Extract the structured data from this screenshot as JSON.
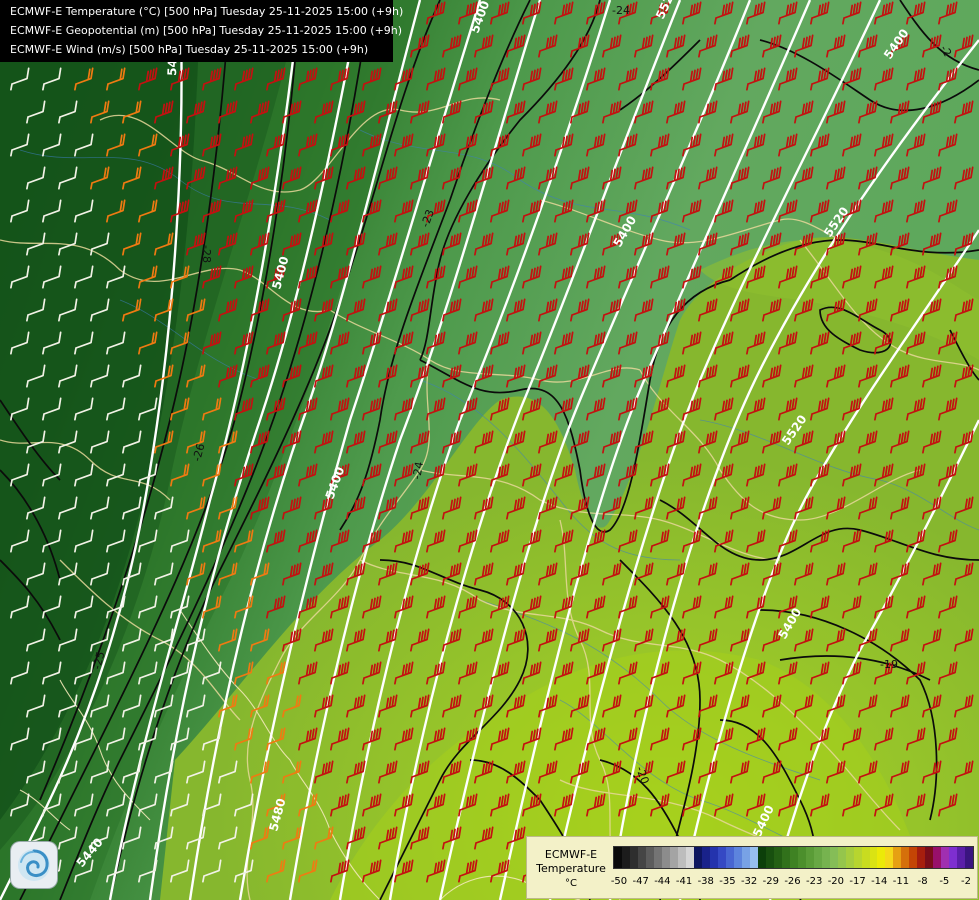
{
  "header": {
    "line1": "ECMWF-E Temperature (°C) [500 hPa] Tuesday 25-11-2025 15:00 (+9h)",
    "line2": "ECMWF-E Geopotential (m) [500 hPa] Tuesday 25-11-2025 15:00 (+9h)",
    "line3": "ECMWF-E Wind (m/s) [500 hPa] Tuesday 25-11-2025 15:00 (+9h)"
  },
  "legend": {
    "title_line1": "ECMWF-E",
    "title_line2": "Temperature",
    "unit": "°C",
    "colors": [
      "#0a0a0a",
      "#1c1c1c",
      "#2e2e2e",
      "#454545",
      "#5c5c5c",
      "#747474",
      "#8c8c8c",
      "#a4a4a4",
      "#bdbdbd",
      "#d5d5d5",
      "#0d1560",
      "#19228a",
      "#2433ad",
      "#3549c4",
      "#4866d2",
      "#5d84dd",
      "#78a2e6",
      "#97bfee",
      "#0c3f0a",
      "#18500f",
      "#246014",
      "#31711b",
      "#3f8223",
      "#4c8f2c",
      "#5a9c37",
      "#68a844",
      "#76b34f",
      "#85bd57",
      "#95c54c",
      "#a6cd3e",
      "#b7d52f",
      "#c8dc20",
      "#dae313",
      "#ecea08",
      "#f5d81a",
      "#e6a013",
      "#d5700b",
      "#c44505",
      "#a61e0e",
      "#7a0d1a",
      "#98106a",
      "#a02fb0",
      "#7e2fd0",
      "#5a1fa8",
      "#3a1580"
    ],
    "tick_labels": [
      "-50",
      "-47",
      "-44",
      "-41",
      "-38",
      "-35",
      "-32",
      "-29",
      "-26",
      "-23",
      "-20",
      "-17",
      "-14",
      "-11",
      "-8",
      "-5",
      "-2"
    ]
  },
  "map": {
    "geopotential_labels": [
      "5400",
      "5400",
      "5520",
      "5400",
      "5400",
      "5520",
      "5400",
      "5400",
      "5480",
      "5440",
      "5520",
      "5400",
      "5400",
      "5400",
      "5480",
      "5400"
    ],
    "temperature_labels": [
      "-24",
      "-28",
      "-23",
      "-26",
      "-24",
      "-25",
      "-19",
      "-20",
      "-2"
    ]
  }
}
